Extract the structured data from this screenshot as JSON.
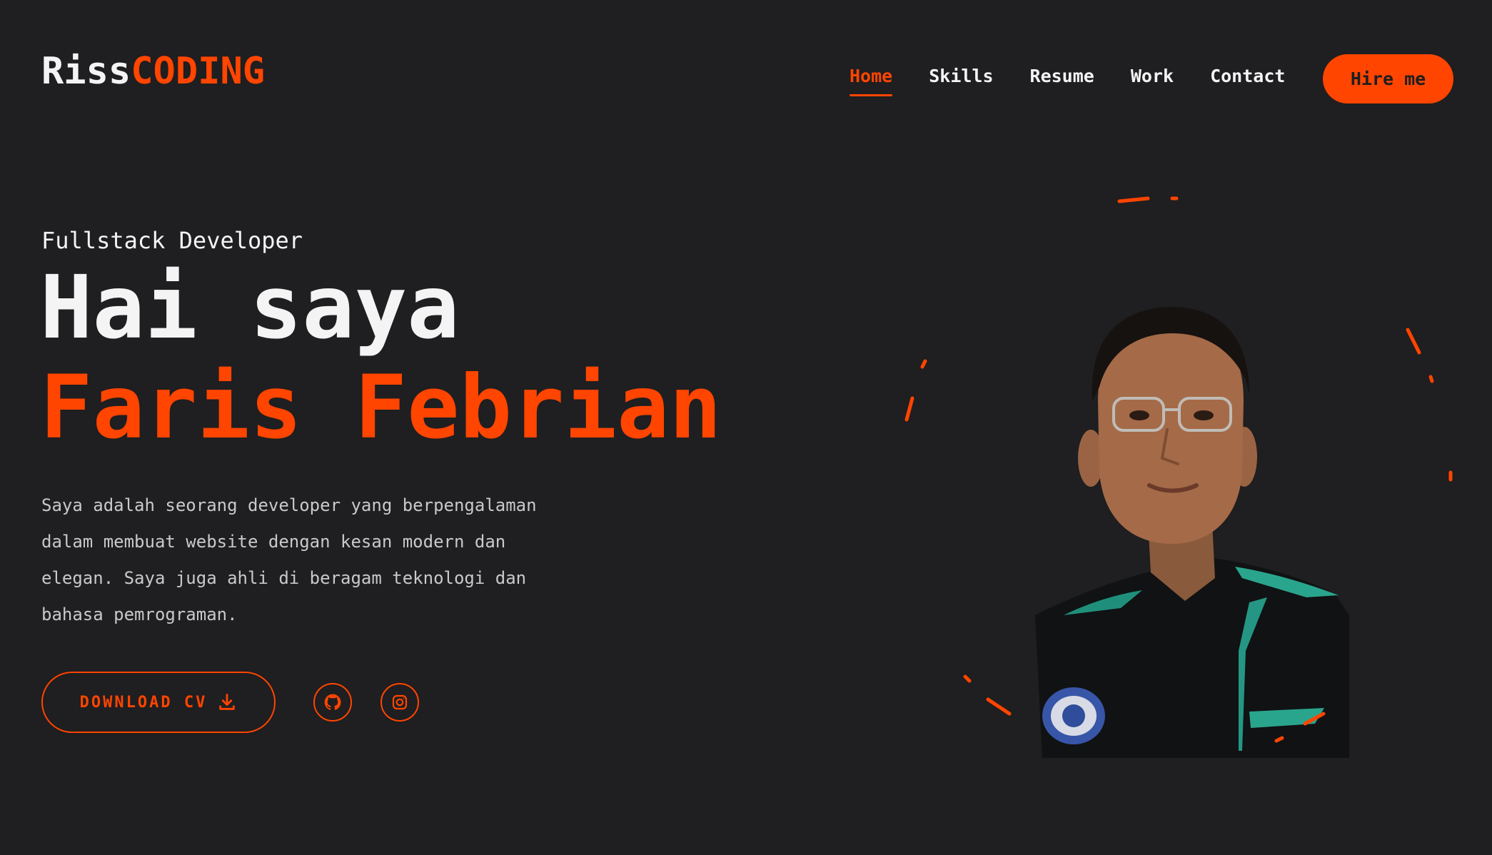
{
  "header": {
    "logo_part1": "Riss",
    "logo_part2": "CODING",
    "nav": [
      {
        "label": "Home",
        "active": true
      },
      {
        "label": "Skills",
        "active": false
      },
      {
        "label": "Resume",
        "active": false
      },
      {
        "label": "Work",
        "active": false
      },
      {
        "label": "Contact",
        "active": false
      }
    ],
    "hire_label": "Hire me"
  },
  "hero": {
    "role": "Fullstack Developer",
    "greeting": "Hai saya",
    "name": "Faris Febrian",
    "description_lines": [
      "Saya adalah seorang developer yang berpengalaman",
      "dalam membuat website dengan kesan modern dan",
      "elegan. Saya juga ahli di beragam teknologi dan",
      "bahasa pemrograman."
    ],
    "cv_label": "DOWNLOAD CV",
    "social_icons": [
      "github-icon",
      "instagram-icon"
    ]
  },
  "colors": {
    "background": "#1f1e20",
    "accent": "#ff4500",
    "text": "#f4f4f5"
  }
}
